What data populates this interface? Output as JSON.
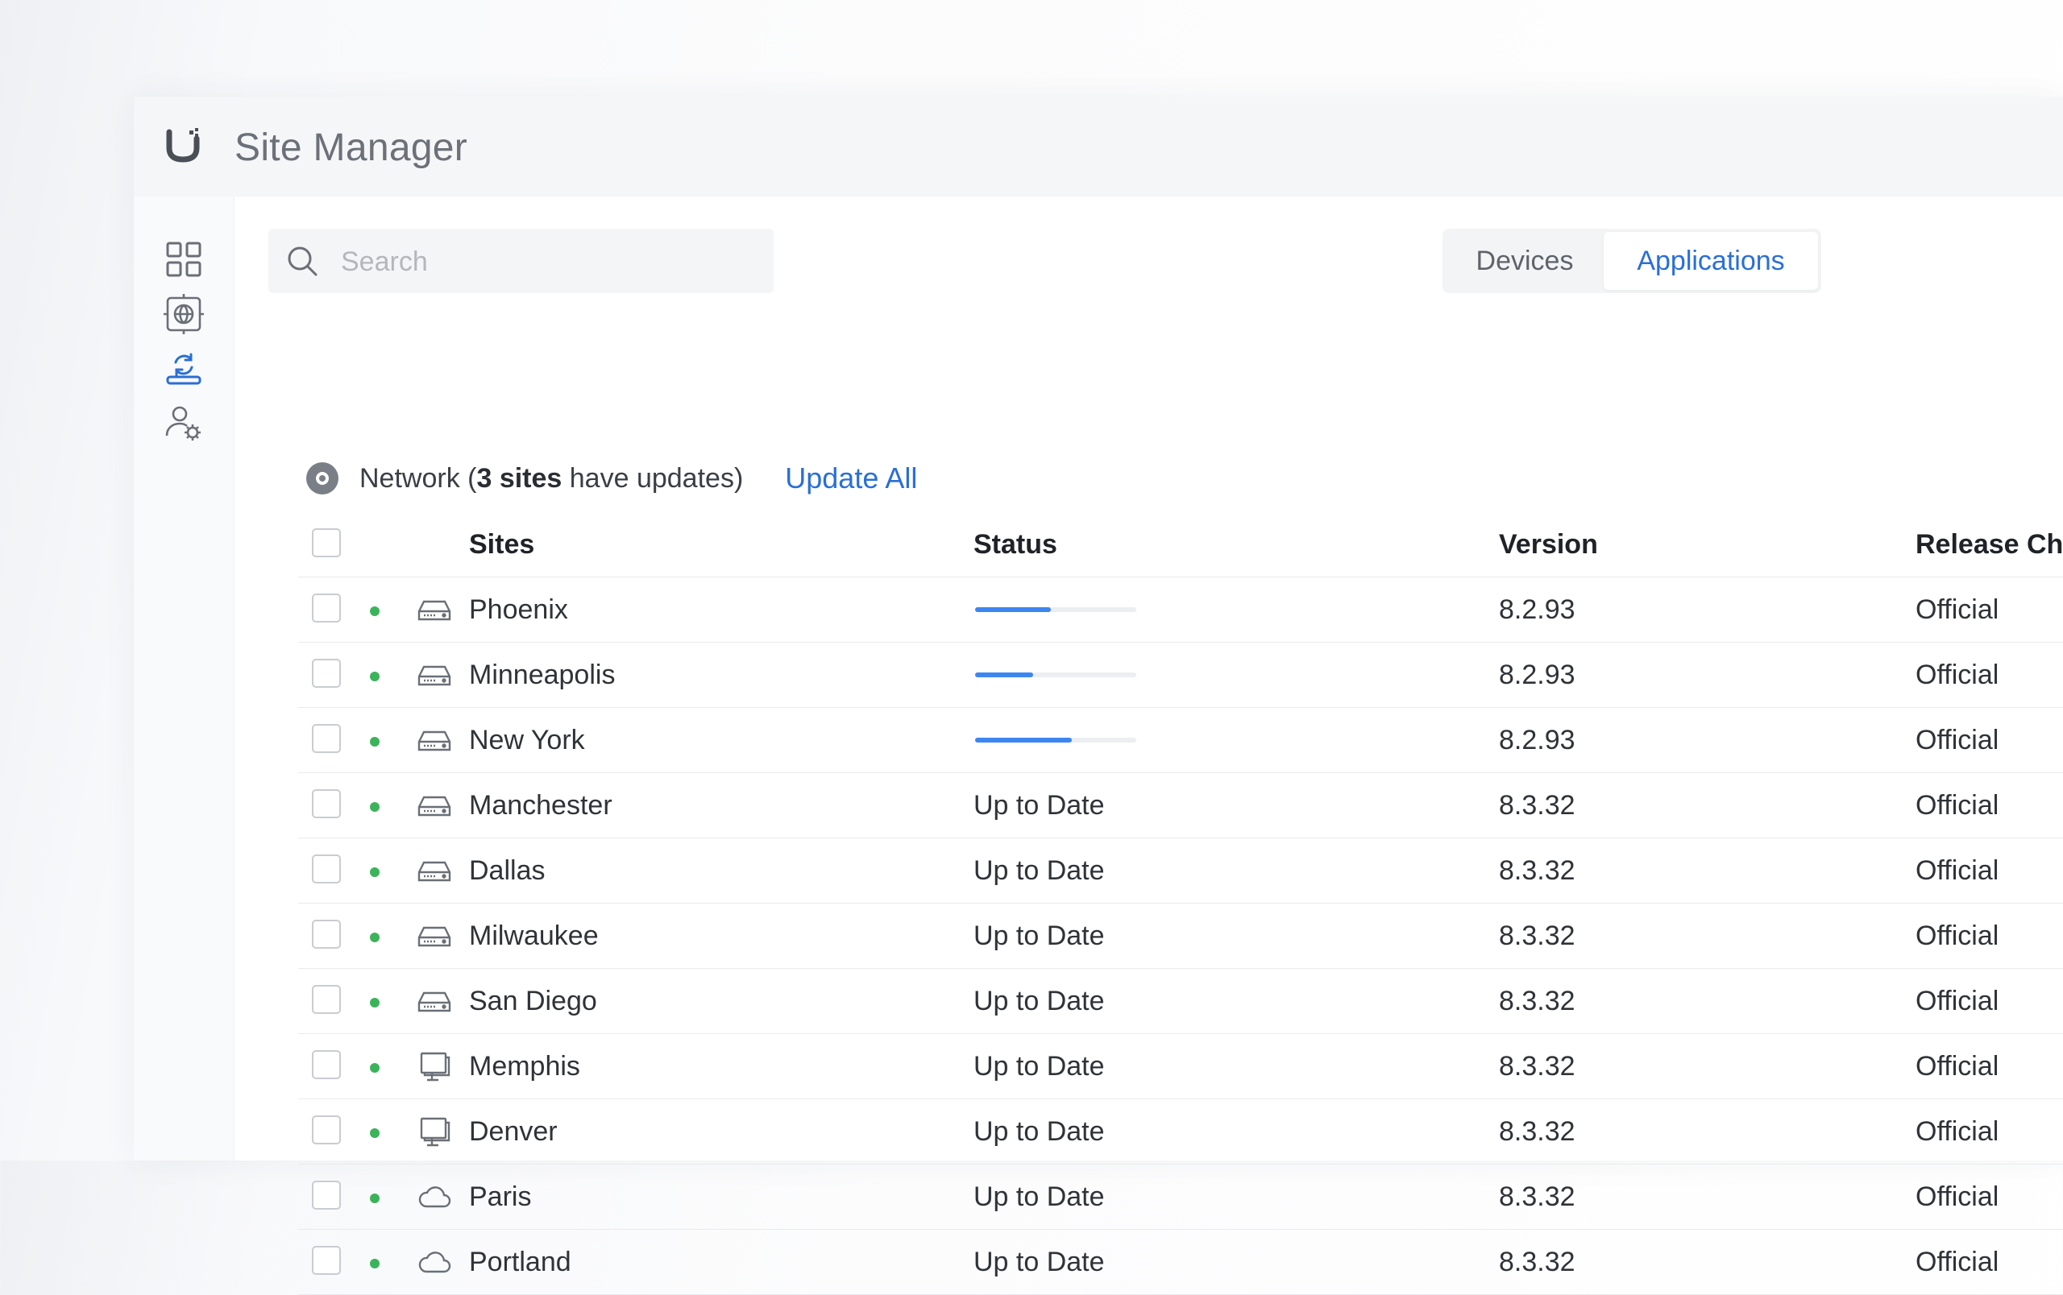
{
  "app": {
    "title": "Site Manager"
  },
  "search": {
    "placeholder": "Search"
  },
  "tabs": [
    {
      "label": "Devices",
      "active": false
    },
    {
      "label": "Applications",
      "active": true
    }
  ],
  "network_group": {
    "prefix": "Network (",
    "bold": "3 sites",
    "suffix": " have updates)",
    "action_label": "Update All"
  },
  "table": {
    "headers": {
      "sites": "Sites",
      "status": "Status",
      "version": "Version",
      "release": "Release Ch"
    },
    "rows": [
      {
        "site": "Phoenix",
        "icon": "gateway-icon",
        "status": "",
        "progress": 0.47,
        "version": "8.2.93",
        "release": "Official"
      },
      {
        "site": "Minneapolis",
        "icon": "gateway-icon",
        "status": "",
        "progress": 0.36,
        "version": "8.2.93",
        "release": "Official"
      },
      {
        "site": "New York",
        "icon": "gateway-icon",
        "status": "",
        "progress": 0.6,
        "version": "8.2.93",
        "release": "Official"
      },
      {
        "site": "Manchester",
        "icon": "gateway-icon",
        "status": "Up to Date",
        "version": "8.3.32",
        "release": "Official"
      },
      {
        "site": "Dallas",
        "icon": "gateway-icon",
        "status": "Up to Date",
        "version": "8.3.32",
        "release": "Official"
      },
      {
        "site": "Milwaukee",
        "icon": "gateway-icon",
        "status": "Up to Date",
        "version": "8.3.32",
        "release": "Official"
      },
      {
        "site": "San Diego",
        "icon": "gateway-icon",
        "status": "Up to Date",
        "version": "8.3.32",
        "release": "Official"
      },
      {
        "site": "Memphis",
        "icon": "monitor-icon",
        "status": "Up to Date",
        "version": "8.3.32",
        "release": "Official"
      },
      {
        "site": "Denver",
        "icon": "monitor-icon",
        "status": "Up to Date",
        "version": "8.3.32",
        "release": "Official"
      },
      {
        "site": "Paris",
        "icon": "cloud-icon",
        "status": "Up to Date",
        "version": "8.3.32",
        "release": "Official"
      },
      {
        "site": "Portland",
        "icon": "cloud-icon",
        "status": "Up to Date",
        "version": "8.3.32",
        "release": "Official"
      }
    ]
  },
  "colors": {
    "accent": "#2a6fd6",
    "progress": "#3d86f0",
    "online": "#3bb35a"
  }
}
